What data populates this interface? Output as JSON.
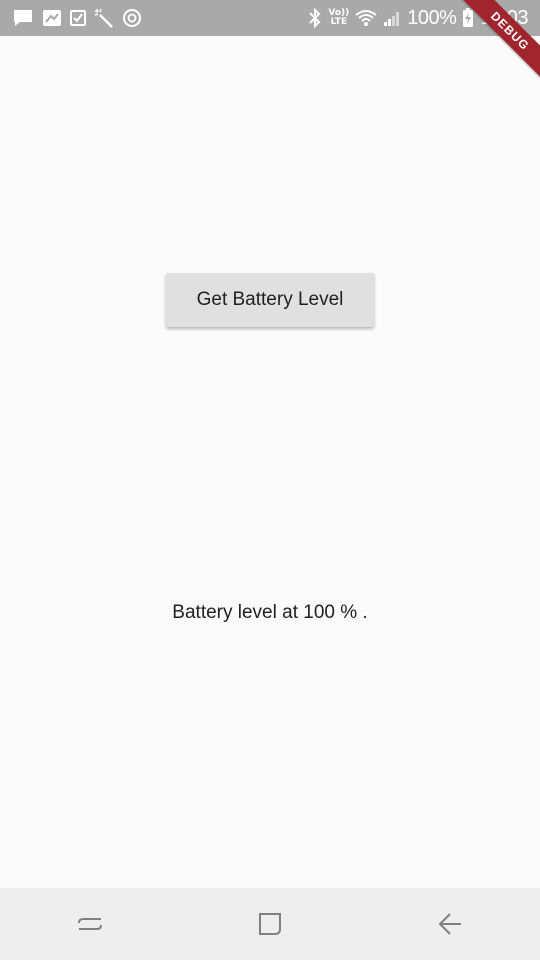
{
  "status_bar": {
    "battery_percent": "100%",
    "time": "12:03",
    "lte_top": "Vo))",
    "lte_bottom": "LTE",
    "icons_left": [
      "message-icon",
      "gallery-icon",
      "checkbox-icon",
      "magic-wand-icon",
      "sync-icon"
    ],
    "icons_right": [
      "bluetooth-icon",
      "volte-icon",
      "wifi-icon",
      "signal-icon",
      "battery-charging-icon"
    ]
  },
  "debug_banner": {
    "label": "DEBUG",
    "color": "#a0252d"
  },
  "main": {
    "button_label": "Get Battery Level",
    "battery_status": "Battery level at 100 % ."
  },
  "nav_bar": {
    "icons": [
      "recent-apps-icon",
      "home-icon",
      "back-icon"
    ]
  }
}
